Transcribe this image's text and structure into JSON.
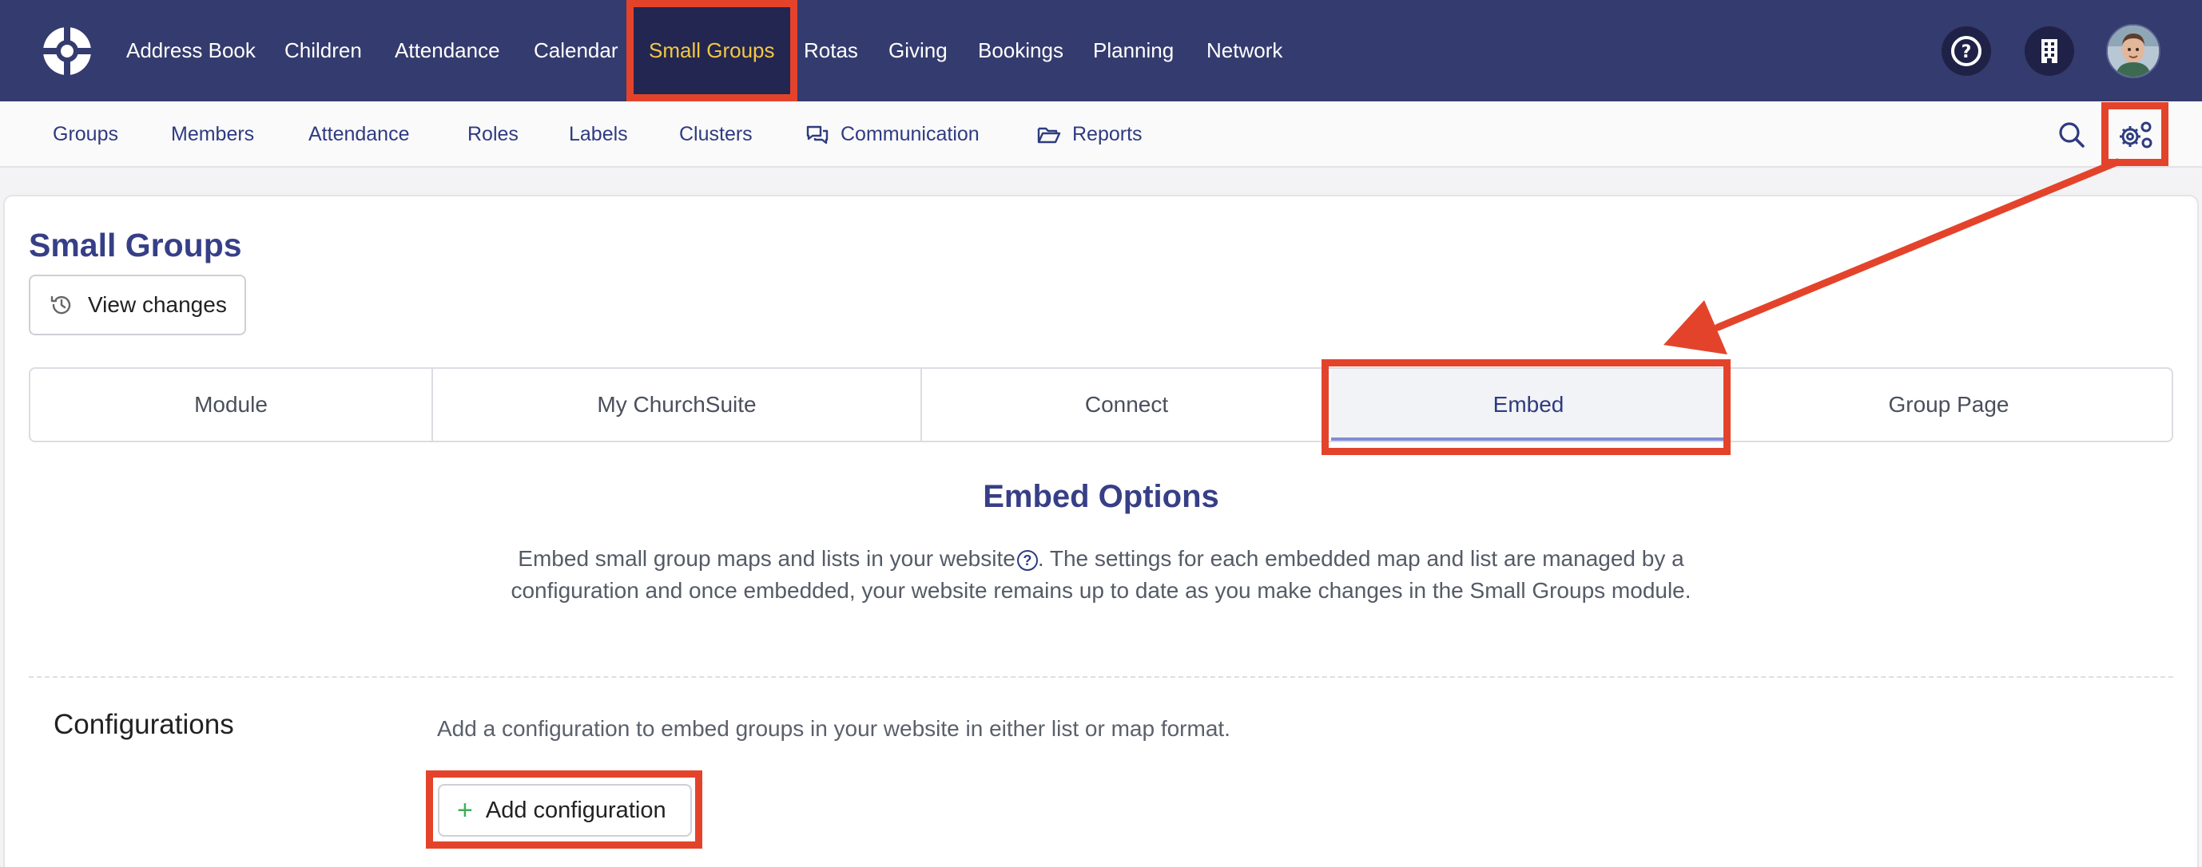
{
  "top_nav": {
    "items": [
      {
        "label": "Address Book"
      },
      {
        "label": "Children"
      },
      {
        "label": "Attendance"
      },
      {
        "label": "Calendar"
      },
      {
        "label": "Small Groups",
        "active": true
      },
      {
        "label": "Rotas"
      },
      {
        "label": "Giving"
      },
      {
        "label": "Bookings"
      },
      {
        "label": "Planning"
      },
      {
        "label": "Network"
      }
    ],
    "help_icon": "?",
    "active_color": "#f2c744",
    "bar_color": "#343b6e"
  },
  "sub_nav": {
    "items": [
      {
        "label": "Groups"
      },
      {
        "label": "Members"
      },
      {
        "label": "Attendance"
      },
      {
        "label": "Roles"
      },
      {
        "label": "Labels"
      },
      {
        "label": "Clusters"
      },
      {
        "label": "Communication",
        "icon": "chat-bubbles-icon"
      },
      {
        "label": "Reports",
        "icon": "folder-open-icon"
      }
    ]
  },
  "page": {
    "title": "Small Groups",
    "view_changes_label": "View changes"
  },
  "tabs": [
    {
      "label": "Module"
    },
    {
      "label": "My ChurchSuite"
    },
    {
      "label": "Connect"
    },
    {
      "label": "Embed",
      "active": true
    },
    {
      "label": "Group Page"
    }
  ],
  "embed": {
    "title": "Embed Options",
    "desc_part1": "Embed small group maps and lists in your website",
    "desc_part2": ". The settings for each embedded map and list are managed by a configuration and once embedded, your website remains up to date as you make changes in the Small Groups module."
  },
  "configurations": {
    "label": "Configurations",
    "description": "Add a configuration to embed groups in your website in either list or map format.",
    "add_label": "Add configuration",
    "add_icon": "+"
  },
  "annotation_color": "#e4432b"
}
